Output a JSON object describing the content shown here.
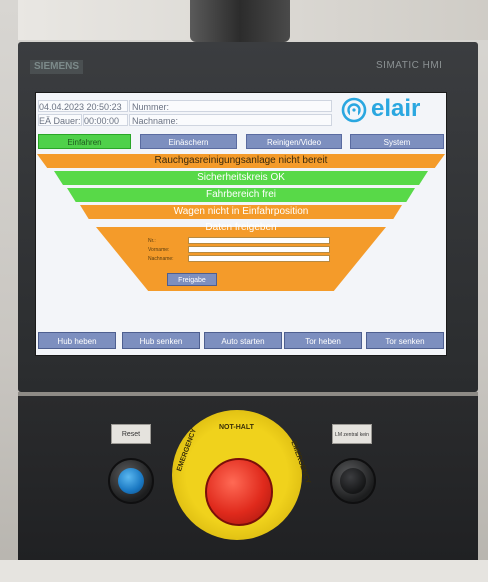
{
  "hardware": {
    "brand_left": "SIEMENS",
    "brand_right": "SIMATIC HMI",
    "reset_label": "Reset",
    "right_plate_label": "LM zentral kein",
    "estop_top": "NOT-HALT",
    "estop_left": "EMERGENCY",
    "estop_right": "EMERGENCY"
  },
  "header": {
    "datetime": "04.04.2023 20:50:23",
    "nummer_label": "Nummer:",
    "ea_dauer_label": "EÄ Dauer:",
    "ea_dauer_value": "00:00:00",
    "nachname_label": "Nachname:",
    "logo_text": "elair"
  },
  "tabs": [
    {
      "label": "Einfahren",
      "active": true
    },
    {
      "label": "Einäschern",
      "active": false
    },
    {
      "label": "Reinigen/Video",
      "active": false
    },
    {
      "label": "System",
      "active": false
    }
  ],
  "status": {
    "rauchgas": "Rauchgasreinigungsanlage nicht bereit",
    "sicherheitskreis": "Sicherheitskreis OK",
    "fahrbereich": "Fahrbereich frei",
    "wagen": "Wagen nicht in Einfahrposition",
    "daten": "Daten freigeben"
  },
  "form": {
    "nr_label": "Nr.:",
    "vorname_label": "Vorname:",
    "nachname_label": "Nachname:",
    "nr_value": "",
    "vorname_value": "",
    "nachname_value": "",
    "freigabe_label": "Freigabe"
  },
  "bottom_buttons": [
    {
      "label": "Hub heben"
    },
    {
      "label": "Hub senken"
    },
    {
      "label": "Auto starten"
    },
    {
      "label": "Tor heben"
    },
    {
      "label": "Tor senken"
    }
  ],
  "colors": {
    "green": "#58d948",
    "orange": "#f49b2a",
    "button_blue": "#7d8fbf",
    "logo_blue": "#2aa7e0"
  }
}
